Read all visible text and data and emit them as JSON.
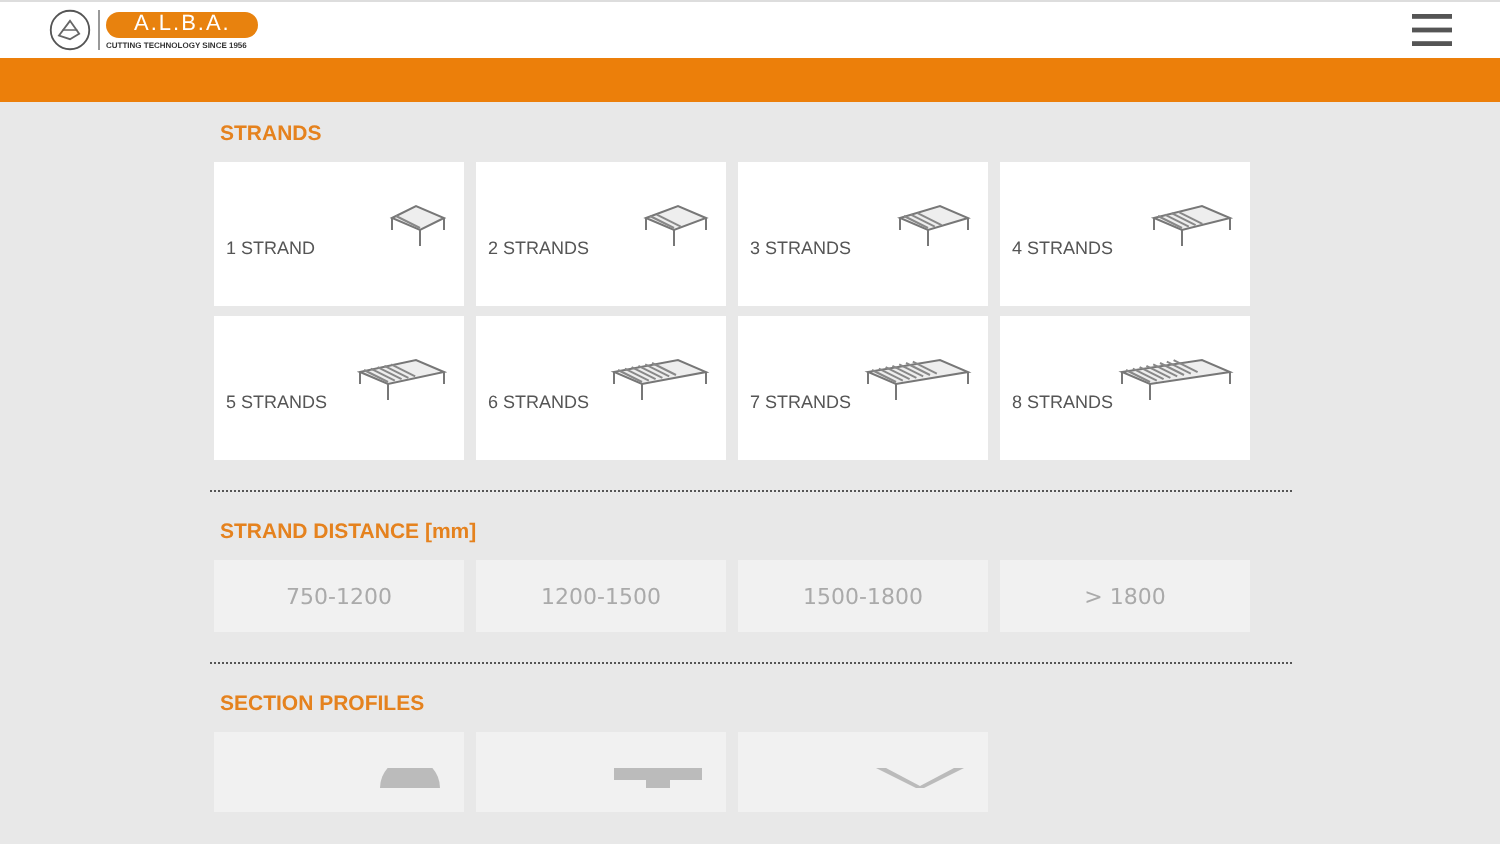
{
  "header": {
    "logo_text": "A.L.B.A.",
    "logo_tagline": "CUTTING TECHNOLOGY SINCE 1956"
  },
  "strands": {
    "title": "STRANDS",
    "options": [
      {
        "label": "1 STRAND"
      },
      {
        "label": "2 STRANDS"
      },
      {
        "label": "3 STRANDS"
      },
      {
        "label": "4 STRANDS"
      },
      {
        "label": "5 STRANDS"
      },
      {
        "label": "6 STRANDS"
      },
      {
        "label": "7 STRANDS"
      },
      {
        "label": "8 STRANDS"
      }
    ]
  },
  "strand_distance": {
    "title": "STRAND DISTANCE [mm]",
    "options": [
      {
        "label": "750-1200",
        "disabled": true
      },
      {
        "label": "1200-1500",
        "disabled": true
      },
      {
        "label": "1500-1800",
        "disabled": true
      },
      {
        "label": "> 1800",
        "disabled": true
      }
    ]
  },
  "section_profiles": {
    "title": "SECTION PROFILES",
    "options": [
      {
        "kind": "round"
      },
      {
        "kind": "beam"
      },
      {
        "kind": "angle"
      }
    ]
  }
}
